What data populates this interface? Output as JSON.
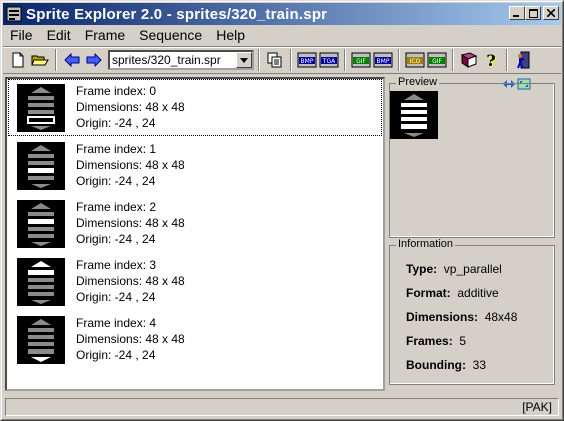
{
  "window": {
    "title": "Sprite Explorer 2.0 - sprites/320_train.spr"
  },
  "menu": {
    "items": [
      "File",
      "Edit",
      "Frame",
      "Sequence",
      "Help"
    ]
  },
  "toolbar": {
    "path_value": "sprites/320_train.spr",
    "bmp_label": "BMP",
    "tga_label": "TGA",
    "gif_label": "GIF",
    "bmp2_label": "BMP",
    "ico_label": "ICO",
    "gif2_label": "GIF",
    "help_glyph": "?"
  },
  "frames": [
    {
      "index_text": "Frame index: 0",
      "dims_text": "Dimensions: 48 x 48",
      "origin_text": "Origin: -24 , 24"
    },
    {
      "index_text": "Frame index: 1",
      "dims_text": "Dimensions: 48 x 48",
      "origin_text": "Origin: -24 , 24"
    },
    {
      "index_text": "Frame index: 2",
      "dims_text": "Dimensions: 48 x 48",
      "origin_text": "Origin: -24 , 24"
    },
    {
      "index_text": "Frame index: 3",
      "dims_text": "Dimensions: 48 x 48",
      "origin_text": "Origin: -24 , 24"
    },
    {
      "index_text": "Frame index: 4",
      "dims_text": "Dimensions: 48 x 48",
      "origin_text": "Origin: -24 , 24"
    }
  ],
  "preview": {
    "title": "Preview"
  },
  "info": {
    "title": "Information",
    "type_label": "Type:",
    "type_value": "vp_parallel",
    "format_label": "Format:",
    "format_value": "additive",
    "dims_label": "Dimensions:",
    "dims_value": "48x48",
    "frames_label": "Frames:",
    "frames_value": "5",
    "bounding_label": "Bounding:",
    "bounding_value": "33"
  },
  "status": {
    "text": "[PAK]"
  },
  "colors": {
    "titlebar_start": "#0a246a",
    "titlebar_end": "#a6caf0",
    "face": "#d4d0c8"
  }
}
